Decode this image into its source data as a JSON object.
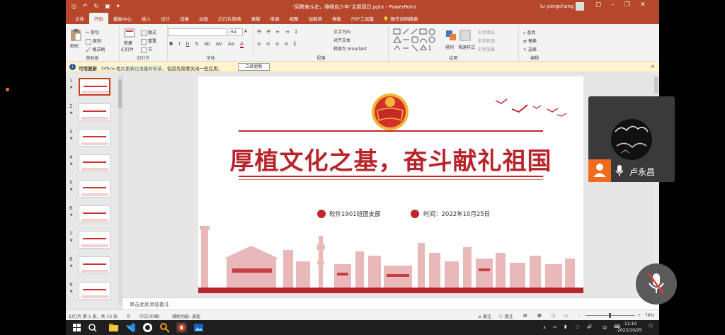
{
  "window": {
    "doc_title": "\"回眸奋斗史，峥嵘启少年\"主题团日.pptx  -  PowerPoint",
    "user": "lu yongchang"
  },
  "tabs": [
    "文件",
    "开始",
    "模板中心",
    "插入",
    "设计",
    "切换",
    "动画",
    "幻灯片放映",
    "录制",
    "审阅",
    "视图",
    "加载项",
    "帮助",
    "PDF工具集"
  ],
  "active_tab": "开始",
  "tell_me": "操作说明搜索",
  "ribbon": {
    "clipboard": {
      "paste": "粘贴",
      "cut": "剪切",
      "copy": "复制",
      "format_painter": "格式刷",
      "label": "剪贴板"
    },
    "slides": {
      "new_slide": "新建",
      "new_slide2": "幻灯片",
      "layout": "版式",
      "reset": "重置",
      "section": "节",
      "label": "幻灯片"
    },
    "font": {
      "size": "64",
      "label": "字体"
    },
    "paragraph": {
      "text_direction": "文字方向",
      "align_text": "对齐文本",
      "smartart": "转换为 SmartArt",
      "label": "段落"
    },
    "drawing": {
      "arrange": "排列",
      "quick_styles": "快速样式",
      "shape_fill": "形状填充",
      "shape_outline": "形状轮廓",
      "shape_effects": "形状效果",
      "label": "绘图"
    },
    "editing": {
      "find": "查找",
      "replace": "替换",
      "select": "选择",
      "label": "编辑"
    }
  },
  "infobar": {
    "title": "可用更新",
    "message_link": "Office 相关更新已准备好安装，",
    "message": "但首先需要关闭一些应用。",
    "button": "立即更新",
    "close": "×"
  },
  "thumbnails": [
    {
      "num": "1",
      "star": "★",
      "selected": true
    },
    {
      "num": "2",
      "star": "★",
      "selected": false
    },
    {
      "num": "3",
      "star": "★",
      "selected": false
    },
    {
      "num": "4",
      "star": "★",
      "selected": false
    },
    {
      "num": "5",
      "star": "★",
      "selected": false
    },
    {
      "num": "6",
      "star": "★",
      "selected": false
    },
    {
      "num": "7",
      "star": "★",
      "selected": false
    },
    {
      "num": "8",
      "star": "★",
      "selected": false
    },
    {
      "num": "9",
      "star": "★",
      "selected": false
    }
  ],
  "slide": {
    "title": "厚植文化之基，奋斗献礼祖国",
    "org": "软件1901班团支部",
    "date": "时间：2022年10月25日",
    "emblem_text": "中国共青团"
  },
  "notes_placeholder": "单击此处添加备注",
  "status": {
    "slide_info": "幻灯片 第 1 张，共 13 张",
    "language": "中文(中国)",
    "accessibility": "辅助功能: 调查",
    "notes": "备注",
    "comments": "批注",
    "zoom": "78%"
  },
  "taskbar": {
    "time": "11:10",
    "date": "2022/10/25",
    "ime": "中"
  },
  "video": {
    "participant_name": "卢永昌"
  },
  "colors": {
    "ppt_accent": "#b7472a",
    "slide_red": "#b8242b",
    "meeting_orange": "#f26b1d"
  }
}
